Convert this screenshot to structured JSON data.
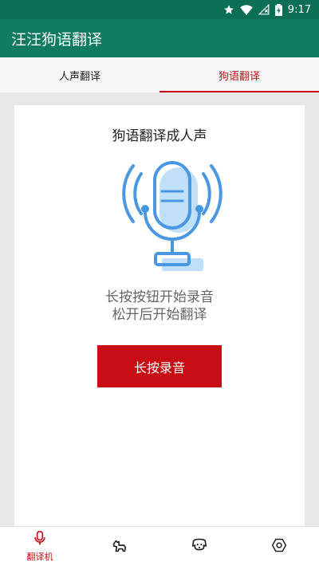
{
  "status_bar": {
    "time": "9:17",
    "icons": [
      "star-icon",
      "wifi-icon",
      "signal-icon",
      "battery-icon"
    ]
  },
  "app": {
    "title": "汪汪狗语翻译",
    "primary_color": "#0f7b60",
    "accent_color": "#c70c14"
  },
  "tabs": [
    {
      "label": "人声翻译",
      "active": false
    },
    {
      "label": "狗语翻译",
      "active": true
    }
  ],
  "card": {
    "title": "狗语翻译成人声",
    "mic_icon": "microphone-icon",
    "instruction_line1": "长按按钮开始录音",
    "instruction_line2": "松开后开始翻译",
    "button_label": "长按录音"
  },
  "bottom_nav": [
    {
      "label": "翻译机",
      "icon": "microphone-icon",
      "active": true
    },
    {
      "label": "",
      "icon": "dog-icon",
      "active": false
    },
    {
      "label": "",
      "icon": "dog-face-icon",
      "active": false
    },
    {
      "label": "",
      "icon": "settings-icon",
      "active": false
    }
  ]
}
